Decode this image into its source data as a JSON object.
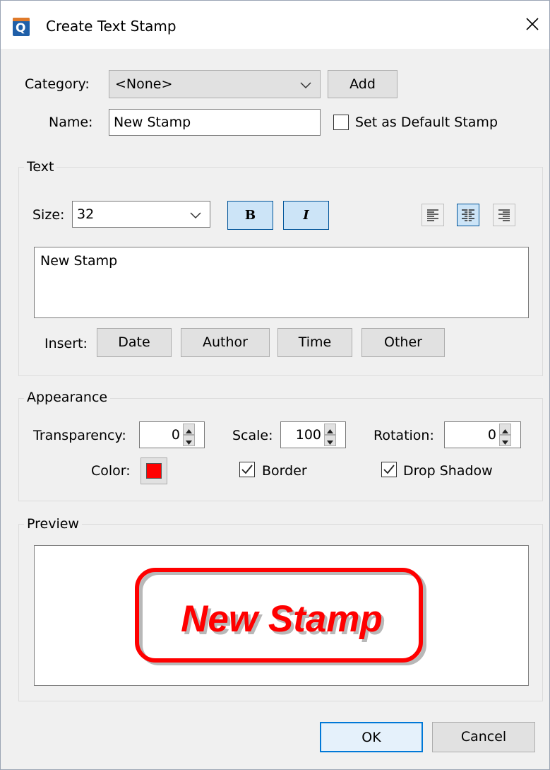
{
  "window": {
    "title": "Create Text Stamp",
    "app_icon_letter": "Q"
  },
  "general": {
    "category_label": "Category:",
    "category_value": "<None>",
    "add_label": "Add",
    "name_label": "Name:",
    "name_value": "New Stamp",
    "default_stamp_label": "Set as Default Stamp",
    "default_stamp_checked": false
  },
  "text_group": {
    "title": "Text",
    "size_label": "Size:",
    "size_value": "32",
    "bold_label": "B",
    "italic_label": "I",
    "bold_active": true,
    "italic_active": true,
    "alignment_active": "center",
    "text_value": "New Stamp",
    "insert_label": "Insert:",
    "insert_buttons": [
      "Date",
      "Author",
      "Time",
      "Other"
    ]
  },
  "appearance": {
    "title": "Appearance",
    "transparency_label": "Transparency:",
    "transparency_value": "0",
    "scale_label": "Scale:",
    "scale_value": "100",
    "rotation_label": "Rotation:",
    "rotation_value": "0",
    "color_label": "Color:",
    "color": "#ff0000",
    "border_label": "Border",
    "border_checked": true,
    "shadow_label": "Drop Shadow",
    "shadow_checked": true
  },
  "preview": {
    "title": "Preview",
    "stamp_text": "New Stamp",
    "stamp_color": "#ff0000"
  },
  "footer": {
    "ok_label": "OK",
    "cancel_label": "Cancel"
  },
  "colors": {
    "dialog_bg": "#f0f0f0",
    "accent_border": "#005499",
    "accent_fill": "#cce4f7"
  }
}
